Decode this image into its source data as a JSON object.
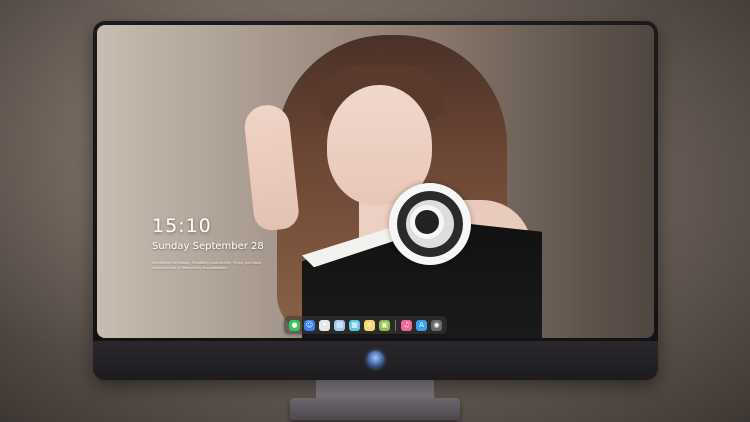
{
  "lock_screen": {
    "time": "15:10",
    "date": "Sunday September 28",
    "tagline": "Interesting technology, Emulating productivity, Trying your ideal companion for a lifetime Bliu, Bonusdedeple"
  },
  "dock": {
    "items": [
      {
        "icon": "messages-icon",
        "color": "#34c759",
        "glyph": "●"
      },
      {
        "icon": "finder-icon",
        "color": "#3b82f6",
        "glyph": "☺"
      },
      {
        "icon": "safari-icon",
        "color": "#e5e7eb",
        "glyph": "✦"
      },
      {
        "icon": "preview-icon",
        "color": "#a3c9f0",
        "glyph": "▤"
      },
      {
        "icon": "clapper-icon",
        "color": "#5ec6e8",
        "glyph": "▦"
      },
      {
        "icon": "notes-icon",
        "color": "#f7d774",
        "glyph": "≡"
      },
      {
        "icon": "photo-icon",
        "color": "#8bc34a",
        "glyph": "▣"
      },
      {
        "icon": "music-icon",
        "color": "#f2669a",
        "glyph": "♫"
      },
      {
        "icon": "app-store-icon",
        "color": "#3aa0f5",
        "glyph": "A"
      },
      {
        "icon": "camera-icon",
        "color": "#6b6b6b",
        "glyph": "◉"
      }
    ]
  }
}
